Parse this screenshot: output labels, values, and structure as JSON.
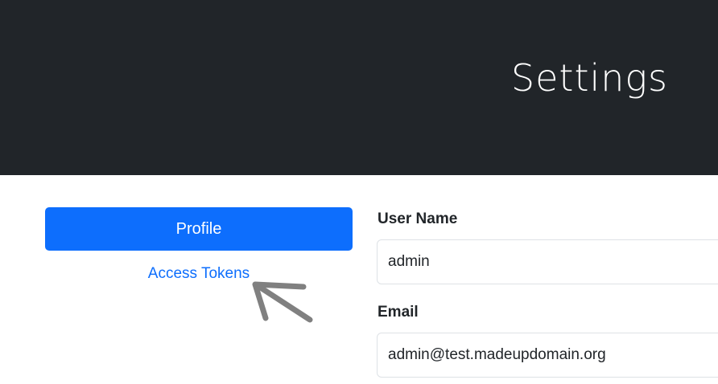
{
  "header": {
    "title": "Settings"
  },
  "nav": {
    "profile_label": "Profile",
    "tokens_label": "Access Tokens"
  },
  "form": {
    "username_label": "User Name",
    "username_value": "admin",
    "email_label": "Email",
    "email_value": "admin@test.madeupdomain.org"
  },
  "colors": {
    "header_bg": "#212529",
    "primary": "#0d6efd",
    "annotation_arrow": "#808080"
  },
  "annotation": {
    "icon": "hand-drawn-arrow-icon"
  }
}
